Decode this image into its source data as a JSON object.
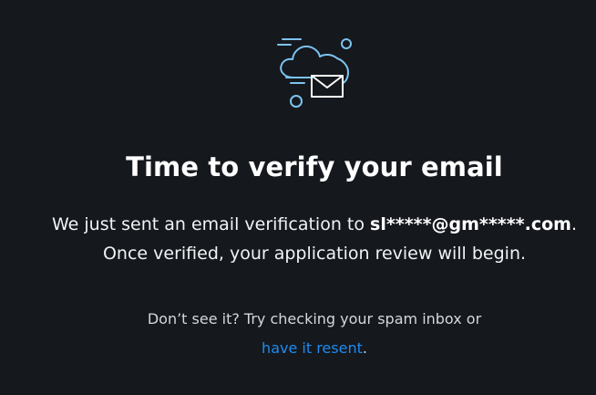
{
  "title": "Time to verify your email",
  "body": {
    "line1_prefix": "We just sent an email verification to ",
    "email": "sl*****@gm*****.com",
    "line1_suffix": ".",
    "line2": "Once verified, your application review will begin."
  },
  "hint": {
    "line1": "Don’t see it? Try checking your spam inbox or",
    "link_label": "have it resent",
    "link_suffix": "."
  },
  "icon": "email-cloud-icon",
  "colors": {
    "background": "#15181d",
    "accent": "#1d8bf0",
    "illustration": "#7cc3f0",
    "text": "#ffffff"
  }
}
